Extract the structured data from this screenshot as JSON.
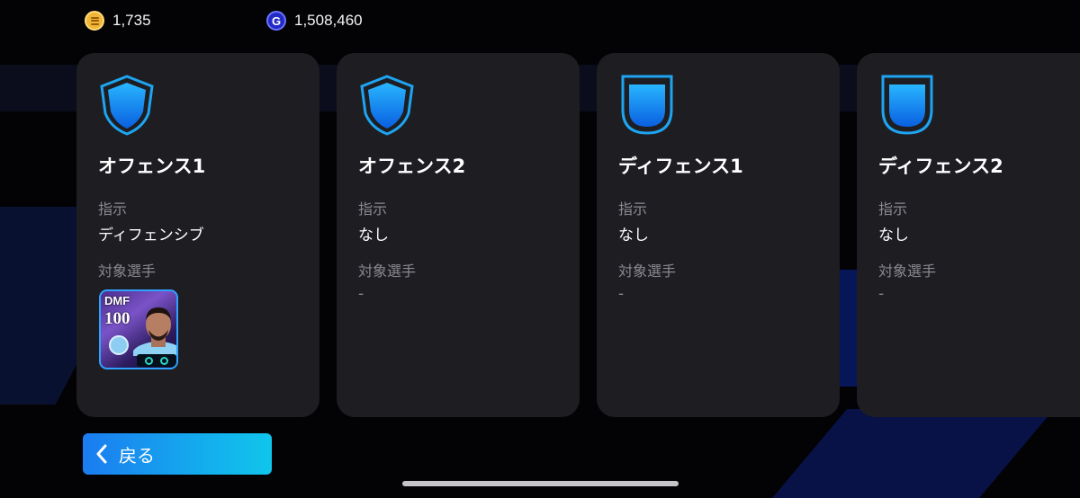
{
  "currencies": {
    "coins": {
      "icon": "gold-coin-icon",
      "value": "1,735"
    },
    "gp": {
      "icon": "gp-coin-icon",
      "value": "1,508,460"
    }
  },
  "cards": [
    {
      "title": "オフェンス1",
      "icon": "shield-icon",
      "instruction_label": "指示",
      "instruction_value": "ディフェンシブ",
      "target_label": "対象選手",
      "target_value": "",
      "player": {
        "position": "DMF",
        "rating": "100"
      }
    },
    {
      "title": "オフェンス2",
      "icon": "shield-icon",
      "instruction_label": "指示",
      "instruction_value": "なし",
      "target_label": "対象選手",
      "target_value": "-"
    },
    {
      "title": "ディフェンス1",
      "icon": "defense-shield-icon",
      "instruction_label": "指示",
      "instruction_value": "なし",
      "target_label": "対象選手",
      "target_value": "-"
    },
    {
      "title": "ディフェンス2",
      "icon": "defense-shield-icon",
      "instruction_label": "指示",
      "instruction_value": "なし",
      "target_label": "対象選手",
      "target_value": "-"
    }
  ],
  "back_button": {
    "label": "戻る",
    "icon": "chevron-left-icon"
  },
  "colors": {
    "accent": "#1ea4f0",
    "card_bg": "#1d1d22",
    "background": "#030306"
  }
}
